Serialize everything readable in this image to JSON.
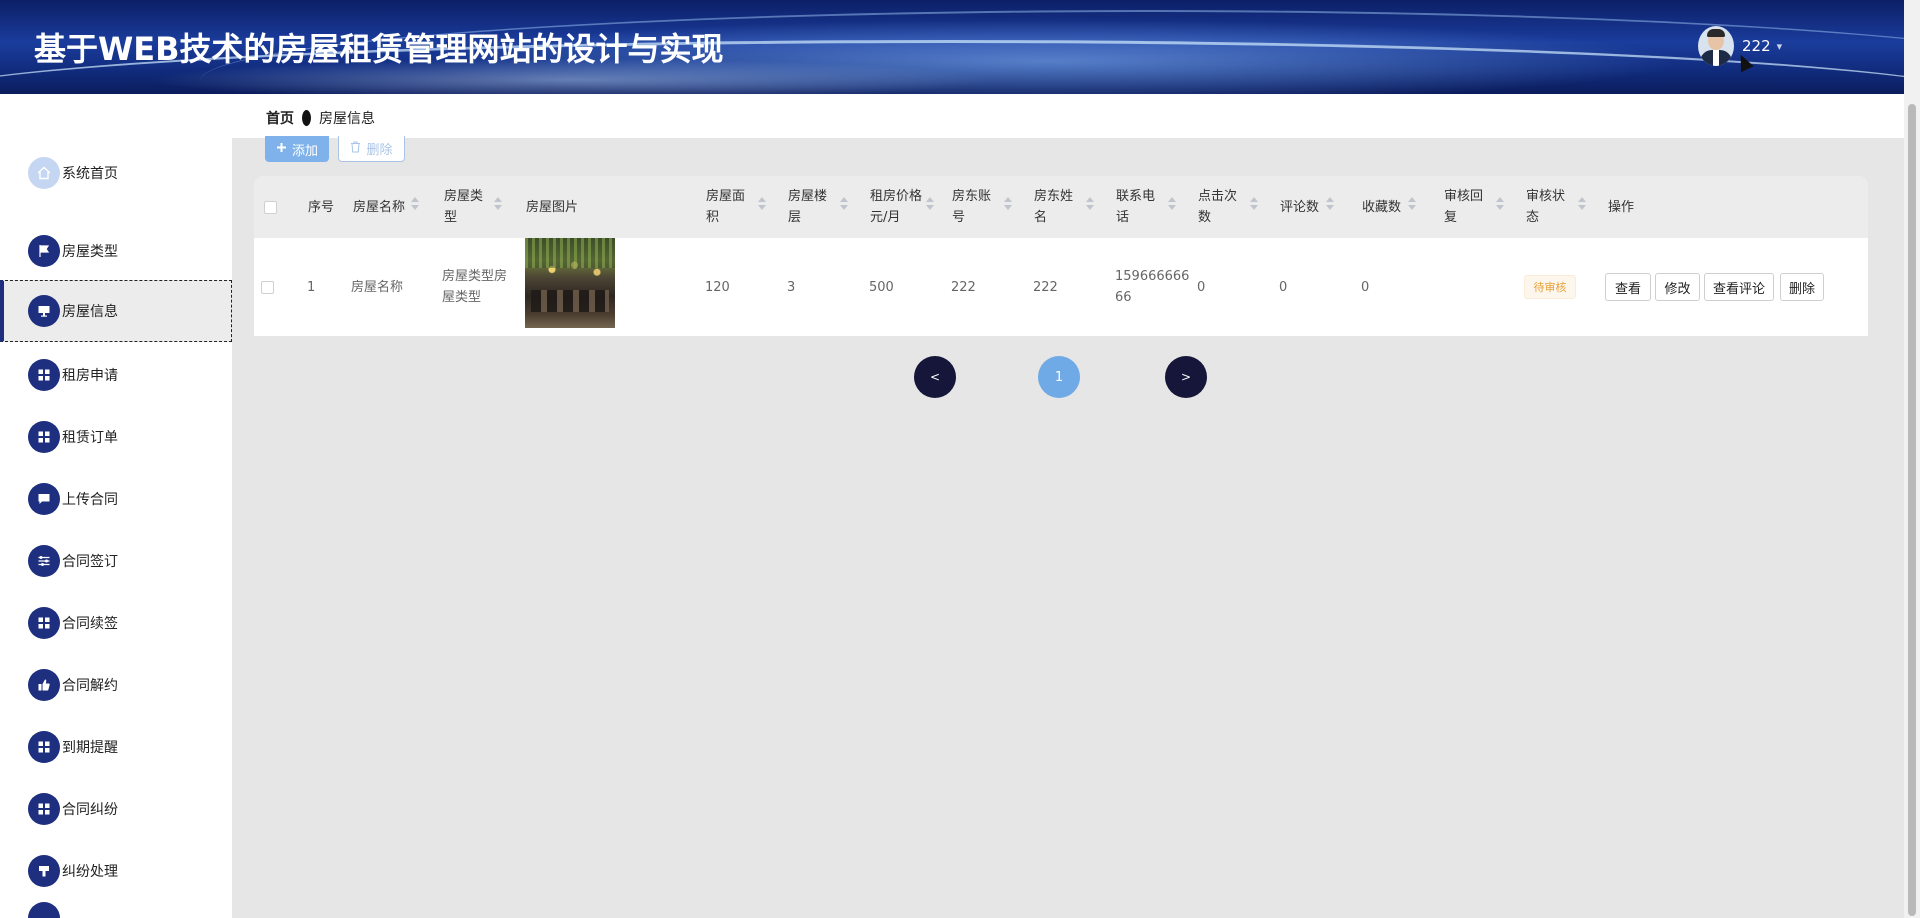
{
  "header": {
    "title": "基于WEB技术的房屋租赁管理网站的设计与实现",
    "username": "222",
    "caret": "▾"
  },
  "sidebar": {
    "items": [
      {
        "label": "系统首页",
        "icon": "home-icon"
      },
      {
        "label": "房屋类型",
        "icon": "flag-icon"
      },
      {
        "label": "房屋信息",
        "icon": "monitor-icon",
        "active": true
      },
      {
        "label": "租房申请",
        "icon": "grid-icon"
      },
      {
        "label": "租赁订单",
        "icon": "grid-icon"
      },
      {
        "label": "上传合同",
        "icon": "chat-icon"
      },
      {
        "label": "合同签订",
        "icon": "sliders-icon"
      },
      {
        "label": "合同续签",
        "icon": "grid-icon"
      },
      {
        "label": "合同解约",
        "icon": "thumb-up-icon"
      },
      {
        "label": "到期提醒",
        "icon": "grid-icon"
      },
      {
        "label": "合同纠纷",
        "icon": "grid-icon"
      },
      {
        "label": "纠纷处理",
        "icon": "podium-icon"
      }
    ]
  },
  "breadcrumb": {
    "home": "首页",
    "current": "房屋信息"
  },
  "toolbar": {
    "add_label": "添加",
    "delete_label": "删除"
  },
  "table": {
    "columns": {
      "index": "序号",
      "name": "房屋名称",
      "type": "房屋类型",
      "image": "房屋图片",
      "area": "房屋面积",
      "floor": "房屋楼层",
      "price": "租房价格元/月",
      "landlord_account": "房东账号",
      "landlord_name": "房东姓名",
      "phone": "联系电话",
      "clicks": "点击次数",
      "comments": "评论数",
      "favorites": "收藏数",
      "review_reply": "审核回复",
      "review_status": "审核状态",
      "actions": "操作"
    },
    "rows": [
      {
        "index": "1",
        "name": "房屋名称",
        "type": "房屋类型房屋类型",
        "area": "120",
        "floor": "3",
        "price": "500",
        "landlord_account": "222",
        "landlord_name": "222",
        "phone": "15966666666",
        "clicks": "0",
        "comments": "0",
        "favorites": "0",
        "review_reply": "",
        "review_status": "待审核",
        "actions": {
          "view": "查看",
          "edit": "修改",
          "view_comments": "查看评论",
          "delete": "删除"
        }
      }
    ]
  },
  "pagination": {
    "prev": "<",
    "current": "1",
    "next": ">"
  },
  "colors": {
    "header_bg": "#1a3c9c",
    "nav_icon_bg": "#1e2f80",
    "add_button": "#7fb2ea",
    "page_current": "#6fa9e6",
    "page_nav": "#16163a",
    "pending_tag": "#e6a23c"
  }
}
